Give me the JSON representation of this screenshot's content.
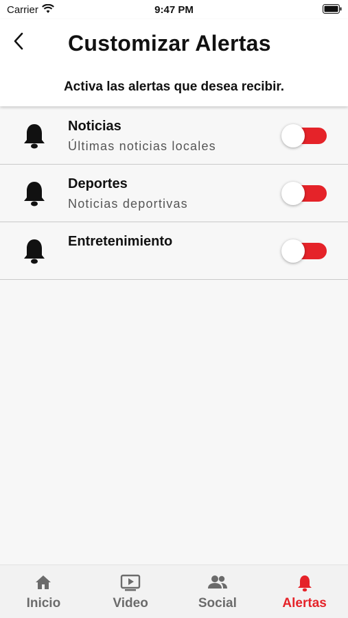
{
  "status_bar": {
    "carrier": "Carrier",
    "time": "9:47 PM"
  },
  "header": {
    "title": "Customizar Alertas",
    "subtitle": "Activa las alertas que desea recibir."
  },
  "alerts": [
    {
      "title": "Noticias",
      "description": "Últimas noticias locales",
      "enabled": false
    },
    {
      "title": "Deportes",
      "description": "Noticias deportivas",
      "enabled": false
    },
    {
      "title": "Entretenimiento",
      "description": "",
      "enabled": false
    }
  ],
  "tabbar": {
    "tabs": [
      {
        "label": "Inicio",
        "icon": "home-icon"
      },
      {
        "label": "Video",
        "icon": "video-icon"
      },
      {
        "label": "Social",
        "icon": "people-icon"
      },
      {
        "label": "Alertas",
        "icon": "bell-icon"
      }
    ],
    "active": "Alertas"
  },
  "colors": {
    "accent": "#e52329",
    "inactive_tab": "#6b6b6b"
  }
}
